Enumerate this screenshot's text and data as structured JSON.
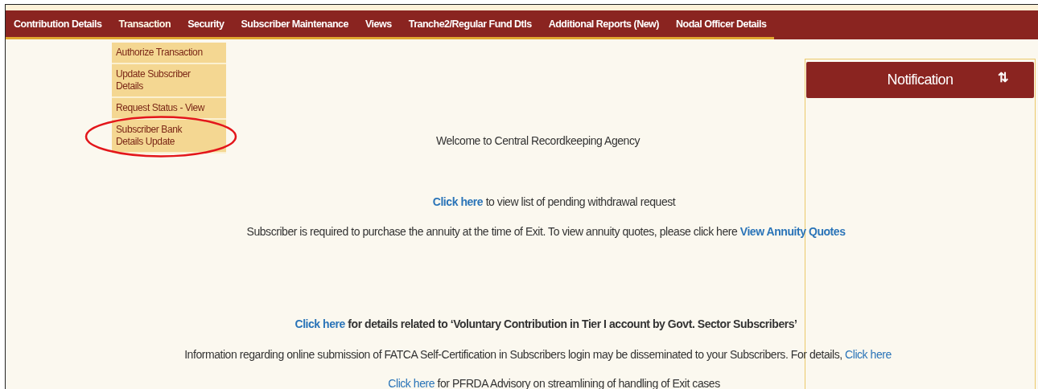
{
  "menu": [
    {
      "label": "Contribution Details",
      "selected": false
    },
    {
      "label": "Transaction",
      "selected": true
    },
    {
      "label": "Security",
      "selected": false
    },
    {
      "label": "Subscriber Maintenance",
      "selected": false
    },
    {
      "label": "Views",
      "selected": false
    },
    {
      "label": "Tranche2/Regular Fund Dtls",
      "selected": false
    },
    {
      "label": "Additional Reports (New)",
      "selected": false
    },
    {
      "label": "Nodal Officer Details",
      "selected": false
    }
  ],
  "dropdown": [
    {
      "label": "Authorize Transaction",
      "circled": false
    },
    {
      "label": "Update Subscriber Details",
      "circled": false
    },
    {
      "label": "Request Status - View",
      "circled": false
    },
    {
      "label": "Subscriber Bank Details Update",
      "circled": true
    }
  ],
  "paragraphs": [
    {
      "parts": [
        {
          "kind": "plain",
          "text": "Welcome to Central Recordkeeping Agency"
        }
      ]
    },
    {
      "parts": [
        {
          "kind": "bold_link",
          "text": "Click here"
        },
        {
          "kind": "plain",
          "text": " to view list of pending withdrawal request"
        }
      ]
    },
    {
      "parts": [
        {
          "kind": "plain",
          "text": "Subscriber is required to purchase the annuity at the time of Exit. To view annuity quotes, please click here "
        },
        {
          "kind": "bold_link",
          "text": "View Annuity Quotes"
        }
      ]
    },
    {
      "parts": [
        {
          "kind": "bold_link",
          "text": "Click here"
        },
        {
          "kind": "bold",
          "text": " for details related to ‘Voluntary Contribution in Tier I account by Govt. Sector Subscribers’"
        }
      ]
    },
    {
      "parts": [
        {
          "kind": "plain",
          "text": "Information regarding online submission of FATCA Self-Certification in Subscribers login may be disseminated to your Subscribers. For details, "
        },
        {
          "kind": "link",
          "text": "Click here"
        }
      ]
    },
    {
      "parts": [
        {
          "kind": "link",
          "text": "Click here"
        },
        {
          "kind": "plain",
          "text": " for PFRDA Advisory on streamlining of handling of Exit cases"
        }
      ]
    }
  ],
  "notification": {
    "title": "Notification",
    "sort_icon": "⇅"
  }
}
